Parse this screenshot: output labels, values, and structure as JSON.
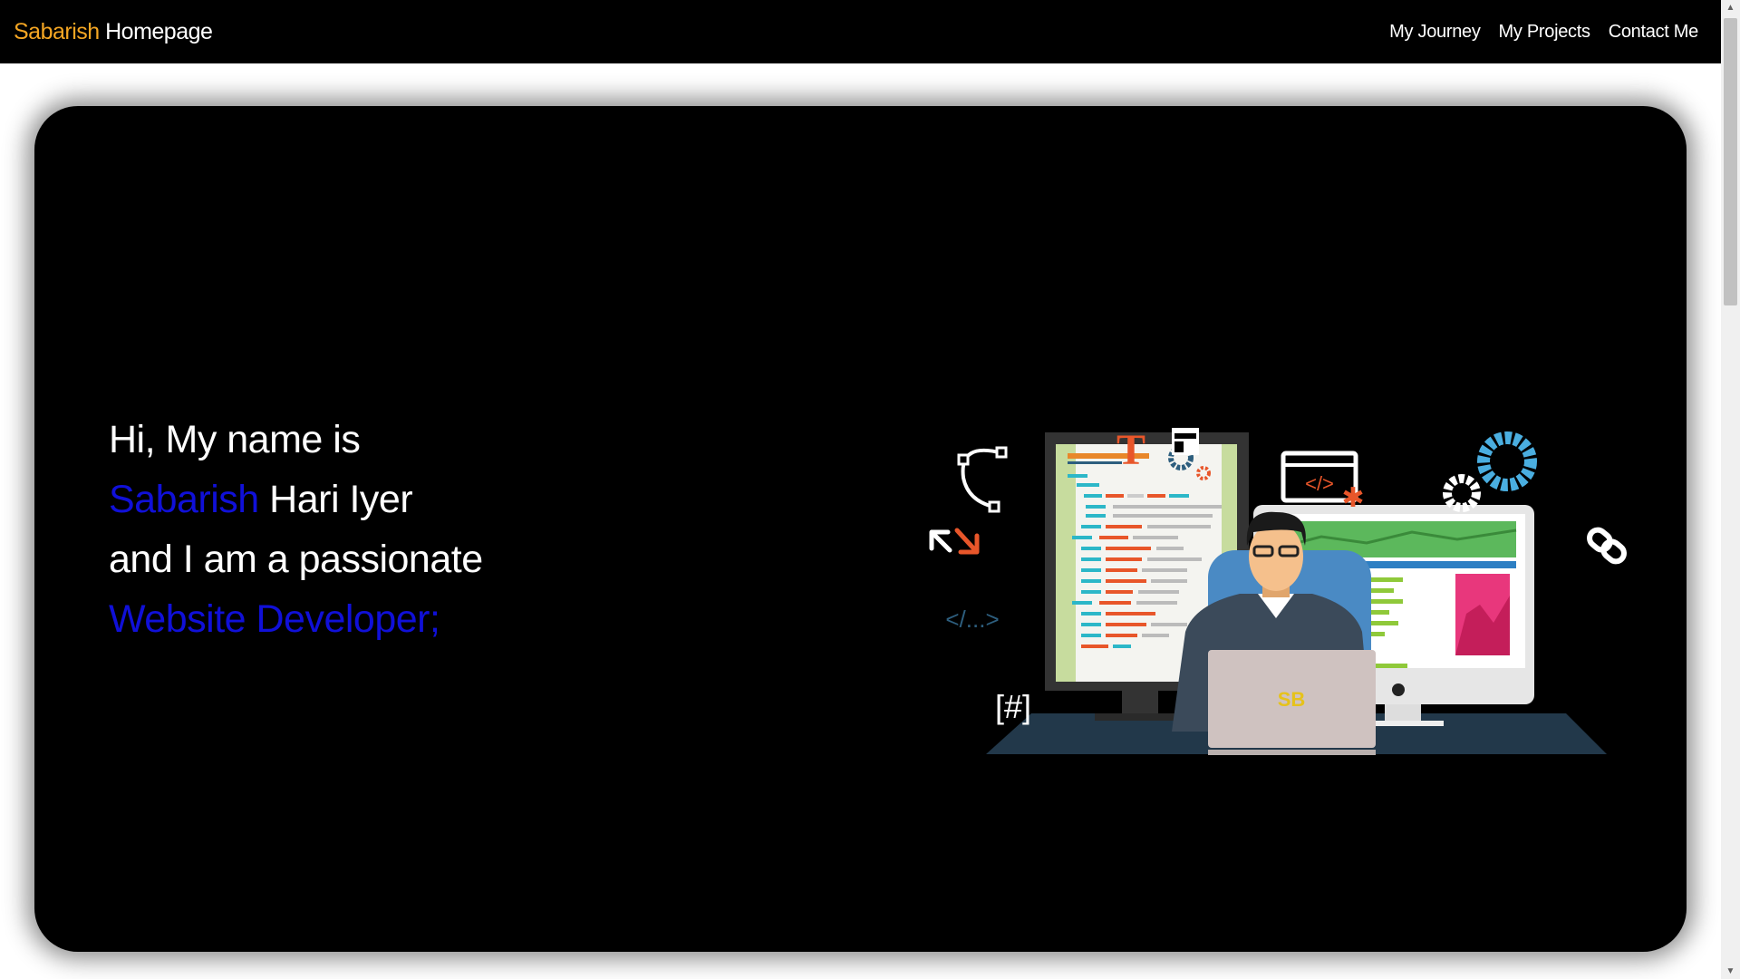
{
  "nav": {
    "brand_accent": "Sabarish",
    "brand_rest": " Homepage",
    "links": [
      "My Journey",
      "My Projects",
      "Contact Me"
    ]
  },
  "intro": {
    "line1": "Hi, My name is",
    "first_name": "Sabarish",
    "last_name": " Hari Iyer",
    "line3": "and I am a passionate",
    "role": "Website Developer;"
  },
  "illustration": {
    "code_tag": "</...>",
    "hash_tag": "[#]",
    "window_code": "</>",
    "letter_t": "T",
    "laptop_logo": "SB"
  },
  "colors": {
    "accent_orange": "#f5a623",
    "text_blue": "#1010d8",
    "background": "#000000"
  }
}
